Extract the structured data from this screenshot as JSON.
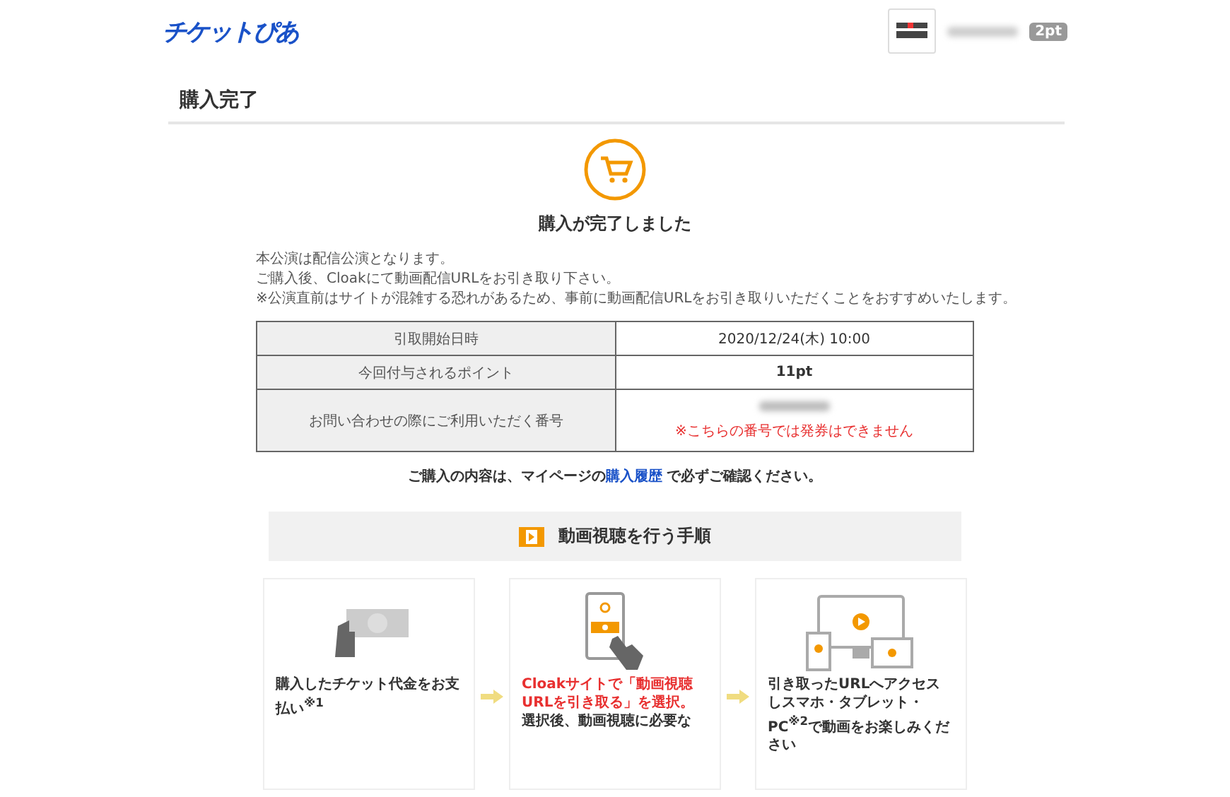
{
  "header": {
    "logo": "チケットぴあ",
    "points_badge": "2pt"
  },
  "page_title": "購入完了",
  "completion": {
    "heading": "購入が完了しました",
    "notes": [
      "本公演は配信公演となります。",
      "ご購入後、Cloakにて動画配信URLをお引き取り下さい。",
      "※公演直前はサイトが混雑する恐れがあるため、事前に動画配信URLをお引き取りいただくことをおすすめいたします。"
    ]
  },
  "table": {
    "rows": [
      {
        "label": "引取開始日時",
        "value": "2020/12/24(木) 10:00",
        "bold": false
      },
      {
        "label": "今回付与されるポイント",
        "value": "11pt",
        "bold": true
      },
      {
        "label": "お問い合わせの際にご利用いただく番号",
        "note": "※こちらの番号では発券はできません"
      }
    ]
  },
  "confirm": {
    "before": "ご購入の内容は、マイページの",
    "link": "購入履歴",
    "after": " で必ずご確認ください。"
  },
  "steps": {
    "title": "動画視聴を行う手順",
    "cards": [
      {
        "kind": "payment",
        "texts": [
          {
            "text": "購入したチケット代金をお支払い$^{※1}$",
            "highlight": false
          }
        ]
      },
      {
        "kind": "phone",
        "texts": [
          {
            "text": "Cloakサイトで「動画視聴URLを引き取る」を選択。",
            "highlight": true
          },
          {
            "text": "選択後、動画視聴に必要な",
            "highlight": false
          }
        ]
      },
      {
        "kind": "devices",
        "texts": [
          {
            "text": "引き取ったURLへアクセスしスマホ・タブレット・PC$^{※2}$で動画をお楽しみください",
            "highlight": false
          }
        ]
      }
    ]
  }
}
